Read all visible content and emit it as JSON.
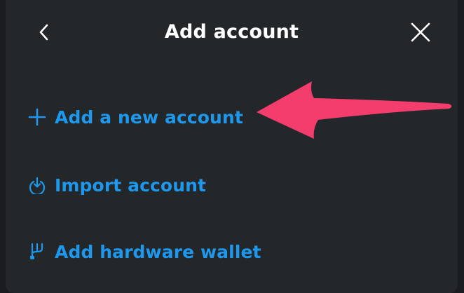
{
  "modal": {
    "title": "Add account"
  },
  "menu": {
    "items": [
      {
        "label": "Add a new account",
        "icon": "plus-icon"
      },
      {
        "label": "Import account",
        "icon": "import-icon"
      },
      {
        "label": "Add hardware wallet",
        "icon": "hardware-wallet-icon"
      }
    ]
  },
  "colors": {
    "accent": "#1e98ec",
    "background": "#24272a",
    "annotation": "#f23d6d"
  }
}
